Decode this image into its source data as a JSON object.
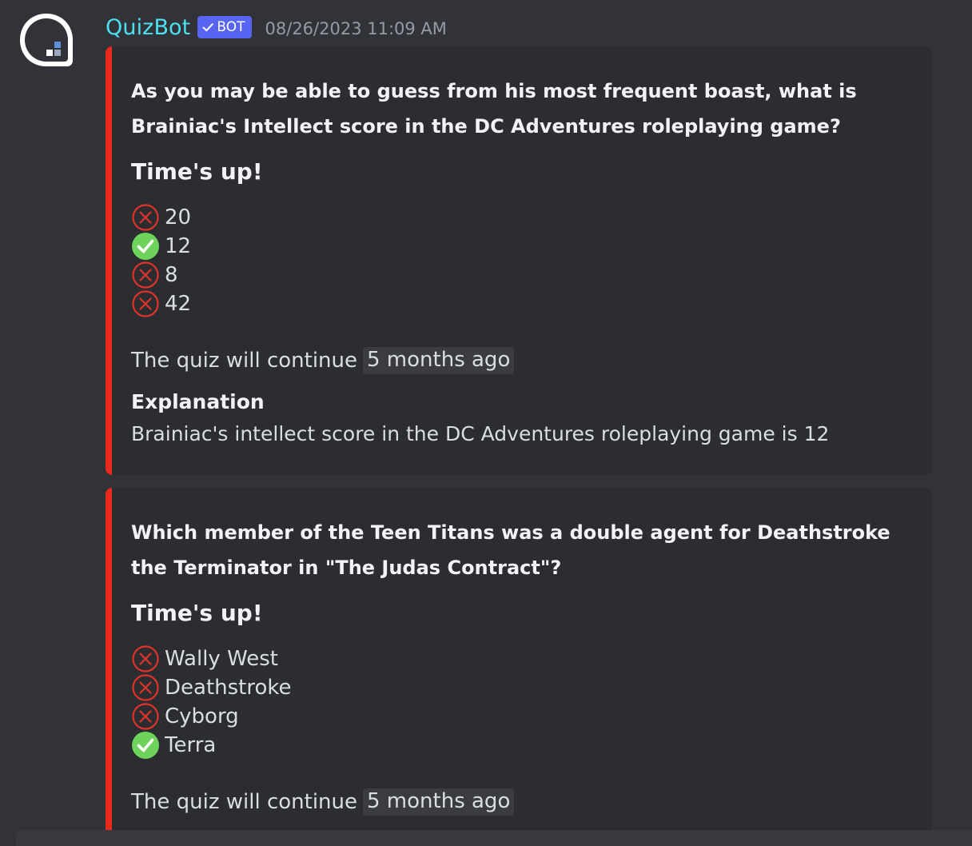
{
  "message": {
    "author": "QuizBot",
    "bot_tag": "BOT",
    "timestamp": "08/26/2023 11:09 AM",
    "avatar_icon": "quizbot-avatar-icon"
  },
  "colors": {
    "username": "#4de0f0",
    "bot_tag_bg": "#5865f2",
    "embed_bar": "#e8291c",
    "correct": "#6dd35a",
    "wrong": "#e0322a"
  },
  "embeds": [
    {
      "question": "As you may be able to guess from his most frequent boast, what is Brainiac's Intellect score in the DC Adventures roleplaying game?",
      "status": "Time's up!",
      "answers": [
        {
          "label": "20",
          "correct": false
        },
        {
          "label": "12",
          "correct": true
        },
        {
          "label": "8",
          "correct": false
        },
        {
          "label": "42",
          "correct": false
        }
      ],
      "continue_text": "The quiz will continue",
      "continue_time": "5 months ago",
      "explanation_title": "Explanation",
      "explanation_text": "Brainiac's intellect score in the DC Adventures roleplaying game is 12"
    },
    {
      "question": "Which member of the Teen Titans was a double agent for Deathstroke the Terminator in \"The Judas Contract\"?",
      "status": "Time's up!",
      "answers": [
        {
          "label": "Wally West",
          "correct": false
        },
        {
          "label": "Deathstroke",
          "correct": false
        },
        {
          "label": "Cyborg",
          "correct": false
        },
        {
          "label": "Terra",
          "correct": true
        }
      ],
      "continue_text": "The quiz will continue",
      "continue_time": "5 months ago"
    }
  ]
}
